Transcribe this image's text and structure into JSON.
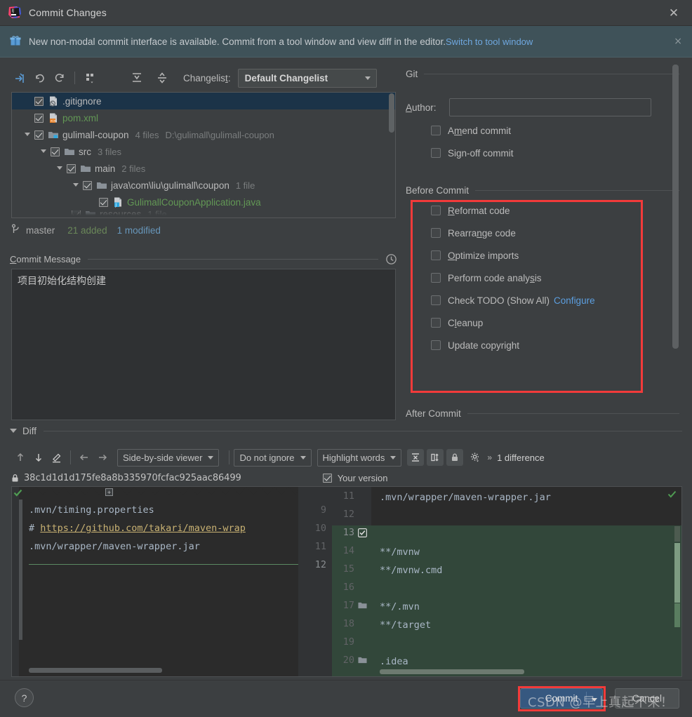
{
  "window": {
    "title": "Commit Changes",
    "close_icon": "close-icon",
    "logo": "intellij-idea-logo"
  },
  "notification": {
    "icon": "gift-icon",
    "message": "New non-modal commit interface is available. Commit from a tool window and view diff in the editor.",
    "link": "Switch to tool window",
    "close": "×"
  },
  "changelist_toolbar": {
    "icons": [
      "show-diff-icon",
      "rollback-icon",
      "refresh-icon",
      "group-by-icon",
      "expand-all-icon",
      "collapse-all-icon"
    ],
    "label": "Changelist:",
    "label_mnemonic": "t",
    "selected": "Default Changelist"
  },
  "file_tree": {
    "rows": [
      {
        "indent": 0,
        "twisty": false,
        "checked": true,
        "icon": "gitignore-file-icon",
        "name": ".gitignore",
        "color": "plain",
        "meta": "",
        "path": "",
        "selected": true
      },
      {
        "indent": 0,
        "twisty": false,
        "checked": true,
        "icon": "xml-file-icon",
        "name": "pom.xml",
        "color": "green",
        "meta": "",
        "path": "",
        "selected": false
      },
      {
        "indent": 0,
        "twisty": true,
        "checked": true,
        "icon": "module-folder-icon",
        "name": "gulimall-coupon",
        "color": "plain",
        "meta": "4 files",
        "path": "D:\\gulimall\\gulimall-coupon",
        "selected": false
      },
      {
        "indent": 1,
        "twisty": true,
        "checked": true,
        "icon": "folder-icon",
        "name": "src",
        "color": "plain",
        "meta": "3 files",
        "path": "",
        "selected": false
      },
      {
        "indent": 2,
        "twisty": true,
        "checked": true,
        "icon": "folder-icon",
        "name": "main",
        "color": "plain",
        "meta": "2 files",
        "path": "",
        "selected": false
      },
      {
        "indent": 3,
        "twisty": true,
        "checked": true,
        "icon": "folder-icon",
        "name": "java\\com\\liu\\gulimall\\coupon",
        "color": "plain",
        "meta": "1 file",
        "path": "",
        "selected": false
      },
      {
        "indent": 4,
        "twisty": false,
        "checked": true,
        "icon": "java-file-icon",
        "name": "GulimallCouponApplication.java",
        "color": "green",
        "meta": "",
        "path": "",
        "selected": false
      }
    ]
  },
  "branch_status": {
    "icon": "branch-icon",
    "branch": "master",
    "added": "21 added",
    "modified": "1 modified"
  },
  "commit_message": {
    "label": "Commit Message",
    "label_mnemonic": "C",
    "history_icon": "clock-history-icon",
    "value": "项目初始化结构创建"
  },
  "options": {
    "git": {
      "title": "Git",
      "author_label": "Author:",
      "author_mnemonic": "A",
      "author_value": "",
      "checks": [
        {
          "label": "Amend commit",
          "mnemonic": "m",
          "checked": false
        },
        {
          "label": "Sign-off commit",
          "mnemonic": "g",
          "checked": false
        }
      ]
    },
    "before_commit": {
      "title": "Before Commit",
      "checks": [
        {
          "label": "Reformat code",
          "mnemonic": "R",
          "checked": false,
          "link": ""
        },
        {
          "label": "Rearrange code",
          "mnemonic": "n",
          "checked": false,
          "link": ""
        },
        {
          "label": "Optimize imports",
          "mnemonic": "O",
          "checked": false,
          "link": ""
        },
        {
          "label": "Perform code analysis",
          "mnemonic": "s",
          "checked": false,
          "link": ""
        },
        {
          "label": "Check TODO (Show All)",
          "mnemonic": "",
          "checked": false,
          "link": "Configure"
        },
        {
          "label": "Cleanup",
          "mnemonic": "l",
          "checked": false,
          "link": ""
        },
        {
          "label": "Update copyright",
          "mnemonic": "",
          "checked": false,
          "link": ""
        }
      ]
    },
    "after_commit": {
      "title": "After Commit"
    }
  },
  "diff": {
    "section_title": "Diff",
    "toolbar": {
      "icons": [
        "previous-difference-icon",
        "next-difference-icon",
        "edit-source-icon",
        "previous-file-icon",
        "next-file-icon"
      ],
      "viewer_mode": "Side-by-side viewer",
      "ignore_mode": "Do not ignore",
      "highlight_mode": "Highlight words",
      "collapse_icon": "collapse-unchanged-icon",
      "align_icon": "align-changes-icon",
      "lock_icon": "read-only-lock-icon",
      "settings_icon": "gear-icon",
      "more_icon": "chevron-more-icon",
      "difference_count": "1 difference"
    },
    "left_header": {
      "lock_icon": "lock-icon",
      "revision": "38c1d1d1d175fe8a8b335970fcfac925aac86499"
    },
    "right_header": {
      "checked": true,
      "label": "Your version"
    },
    "left_lines": [
      {
        "num": "9",
        "text": ".mvn/timing.properties",
        "style": "normal"
      },
      {
        "num": "10",
        "text": "# https://github.com/takari/maven-wrap",
        "style": "link"
      },
      {
        "num": "11",
        "text": ".mvn/wrapper/maven-wrapper.jar",
        "style": "normal"
      },
      {
        "num": "12",
        "text": "",
        "style": "normal"
      }
    ],
    "right_lines": [
      {
        "num": "11",
        "text": ".mvn/wrapper/maven-wrapper.jar",
        "added": false,
        "folder": false,
        "check": false
      },
      {
        "num": "12",
        "text": "",
        "added": false,
        "folder": false,
        "check": false
      },
      {
        "num": "13",
        "text": "",
        "added": true,
        "folder": false,
        "check": true
      },
      {
        "num": "14",
        "text": "**/mvnw",
        "added": true,
        "folder": false,
        "check": false
      },
      {
        "num": "15",
        "text": "**/mvnw.cmd",
        "added": true,
        "folder": false,
        "check": false
      },
      {
        "num": "16",
        "text": "",
        "added": true,
        "folder": false,
        "check": false
      },
      {
        "num": "17",
        "text": "**/.mvn",
        "added": true,
        "folder": true,
        "check": false
      },
      {
        "num": "18",
        "text": "**/target",
        "added": true,
        "folder": false,
        "check": false
      },
      {
        "num": "19",
        "text": "",
        "added": true,
        "folder": false,
        "check": false
      },
      {
        "num": "20",
        "text": ".idea",
        "added": true,
        "folder": true,
        "check": false
      }
    ]
  },
  "footer": {
    "help_label": "?",
    "commit_label": "Commit",
    "cancel_label": "Cancel",
    "watermark": "CSDN @早上真起不来！"
  }
}
